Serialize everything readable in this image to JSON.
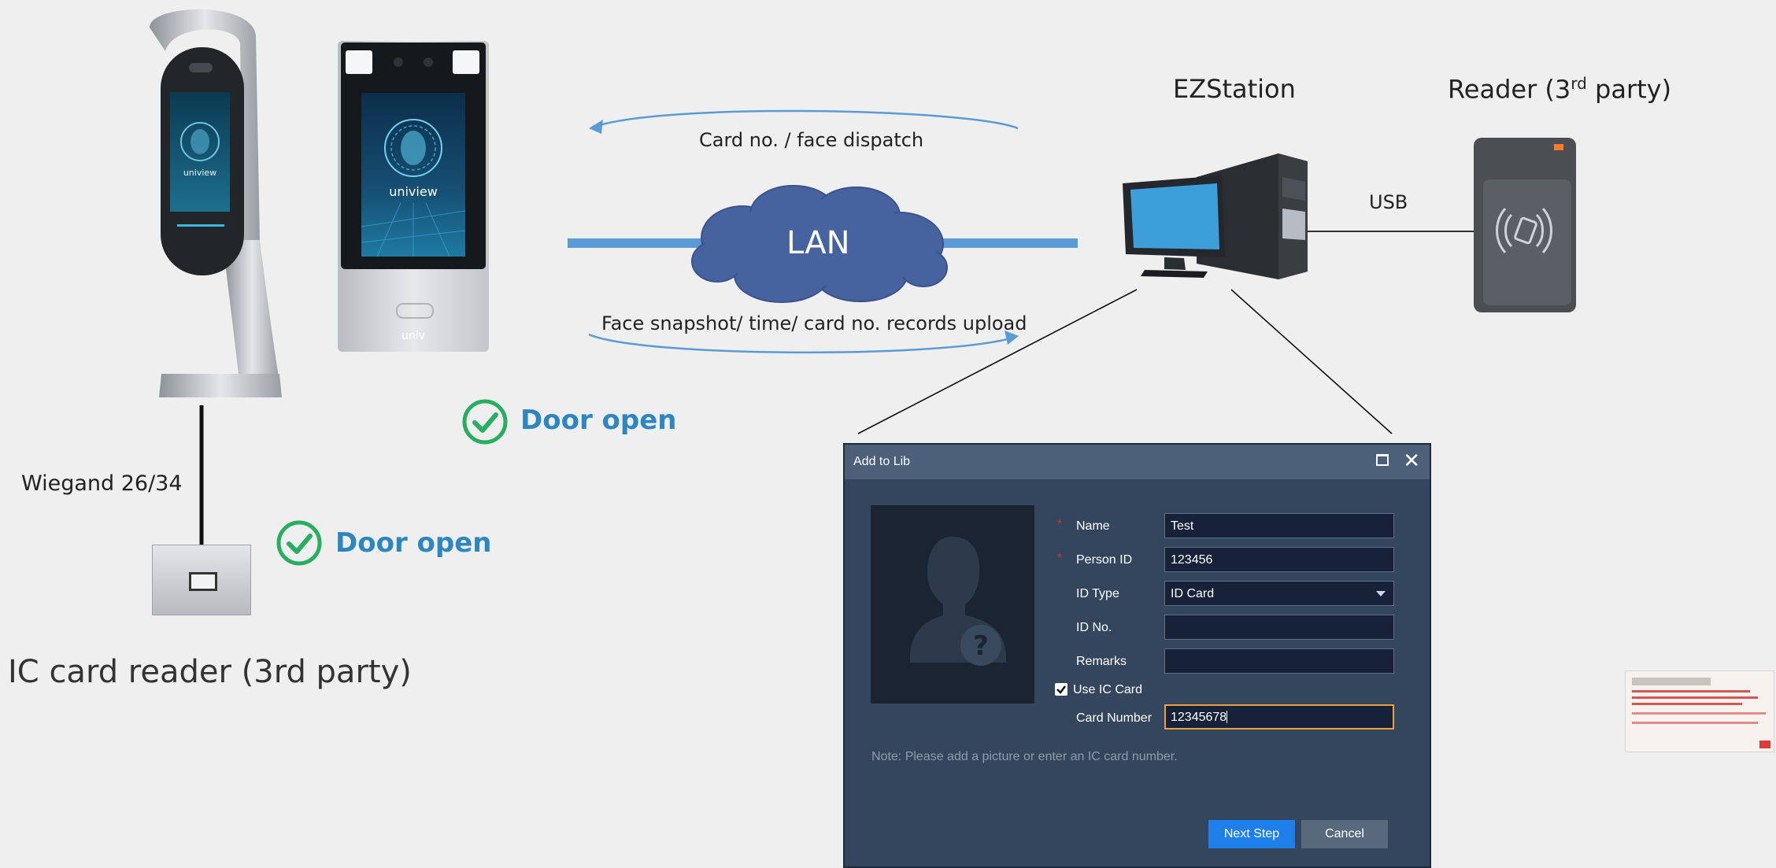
{
  "labels": {
    "ezstation": "EZStation",
    "reader_main": "Reader (3",
    "reader_sup": "rd",
    "reader_tail": " party)",
    "usb": "USB",
    "lan": "LAN",
    "dispatch": "Card no. / face dispatch",
    "upload": "Face snapshot/ time/ card no. records upload",
    "wiegand": "Wiegand 26/34",
    "ic_reader": "IC card reader (3rd party)",
    "door_open_1": "Door open",
    "door_open_2": "Door open",
    "device_brand": "uniview",
    "device_brand_small": "univ"
  },
  "dialog": {
    "title": "Add to Lib",
    "fields": {
      "name_label": "Name",
      "name_value": "Test",
      "person_id_label": "Person ID",
      "person_id_value": "123456",
      "id_type_label": "ID Type",
      "id_type_value": "ID Card",
      "id_no_label": "ID No.",
      "id_no_value": "",
      "remarks_label": "Remarks",
      "remarks_value": "",
      "use_ic_label": "Use IC Card",
      "card_number_label": "Card Number",
      "card_number_value": "12345678"
    },
    "required_mark": "*",
    "note": "Note: Please add a picture or enter an IC card number.",
    "next_label": "Next Step",
    "cancel_label": "Cancel"
  },
  "colors": {
    "background": "#efefef",
    "cloud": "#4663a0",
    "arrow": "#5b9bd5",
    "door_open": "#2e86c1",
    "check": "#27ae60",
    "dialog_bg": "#34465d",
    "primary_button": "#1f7fea"
  },
  "icons": {
    "check": "check-circle-icon",
    "close": "close-icon",
    "maximize": "maximize-icon",
    "avatar": "unknown-person-icon",
    "dropdown": "chevron-down-icon"
  }
}
